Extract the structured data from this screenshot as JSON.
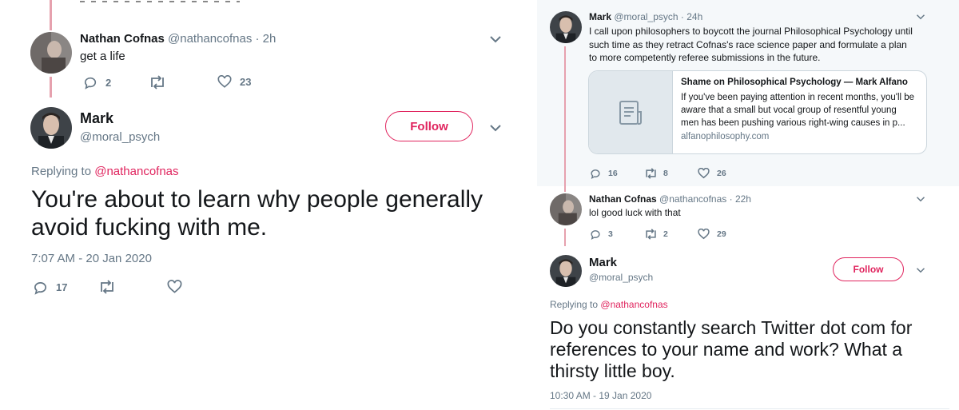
{
  "left": {
    "parent_tweet": {
      "name": "Nathan Cofnas",
      "handle": "@nathancofnas",
      "time": "· 2h",
      "text": "get a life",
      "actions": {
        "replies": "2",
        "retweets": "",
        "likes": "23"
      }
    },
    "main_tweet": {
      "name": "Mark",
      "handle": "@moral_psych",
      "follow_label": "Follow",
      "replying_prefix": "Replying to",
      "replying_to": "@nathancofnas",
      "text": "You're about to learn why people generally avoid fucking with me.",
      "timestamp": "7:07 AM - 20 Jan 2020",
      "actions": {
        "replies": "17",
        "retweets": "",
        "likes": ""
      }
    }
  },
  "right": {
    "first_tweet": {
      "name": "Mark",
      "handle": "@moral_psych",
      "time": "· 24h",
      "text": "I call upon philosophers to boycott the journal Philosophical Psychology until such time as they retract Cofnas's race science paper and formulate a plan to more competently referee submissions in the future.",
      "card": {
        "title": "Shame on Philosophical Psychology — Mark Alfano",
        "description": "If you've been paying attention in recent months, you'll be aware that a small but vocal group of resentful young men has been pushing various right-wing causes in p...",
        "domain": "alfanophilosophy.com"
      },
      "actions": {
        "replies": "16",
        "retweets": "8",
        "likes": "26"
      }
    },
    "reply_tweet": {
      "name": "Nathan Cofnas",
      "handle": "@nathancofnas",
      "time": "· 22h",
      "text": "lol good luck with that",
      "actions": {
        "replies": "3",
        "retweets": "2",
        "likes": "29"
      }
    },
    "main_tweet": {
      "name": "Mark",
      "handle": "@moral_psych",
      "follow_label": "Follow",
      "replying_prefix": "Replying to",
      "replying_to": "@nathancofnas",
      "text": "Do you constantly search Twitter dot com for references to your name and work? What a thirsty little boy.",
      "timestamp": "10:30 AM - 19 Jan 2020"
    }
  },
  "colors": {
    "accent": "#e0245e",
    "thread_line": "#e6a1ae",
    "muted": "#657786",
    "highlight_bg": "#f5f8fa"
  }
}
